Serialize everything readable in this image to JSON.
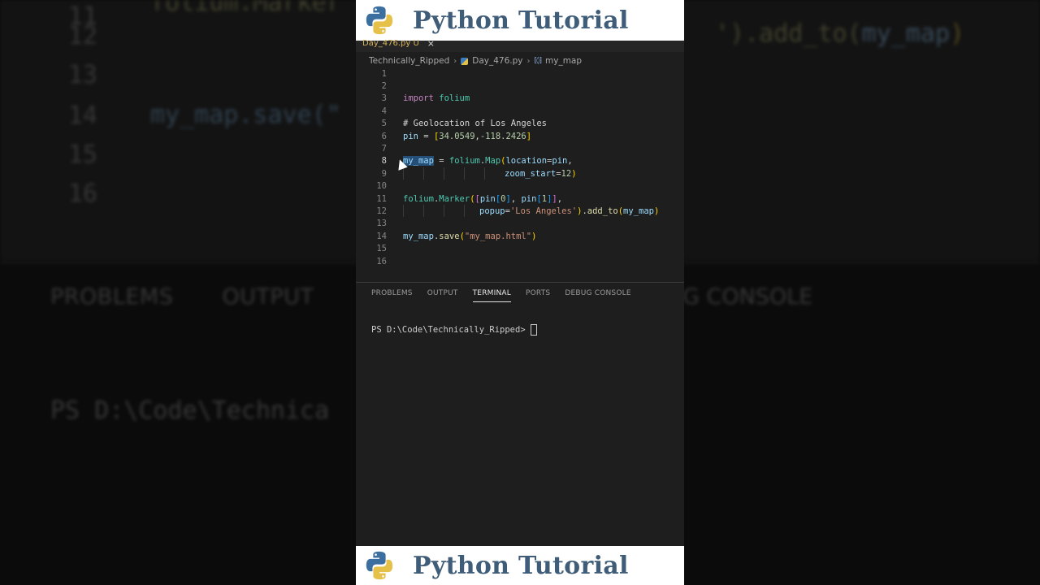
{
  "banner": {
    "title": "Python Tutorial"
  },
  "editor": {
    "tab_label": "Day_476.py U",
    "close_glyph": "×",
    "breadcrumb": [
      "Technically_Ripped",
      "Day_476.py",
      "my_map"
    ],
    "line_numbers": [
      "1",
      "2",
      "3",
      "4",
      "5",
      "6",
      "7",
      "8",
      "9",
      "10",
      "11",
      "12",
      "13",
      "14",
      "15",
      "16"
    ],
    "code": {
      "l3_import": "import",
      "l3_mod": "folium",
      "l5_comment": "# Geolocation of Los Angeles",
      "l6_var": "pin",
      "l6_eq": " = ",
      "l6_open": "[",
      "l6_num1": "34.0549",
      "l6_comma": ",",
      "l6_num2": "-118.2426",
      "l6_close": "]",
      "l8_var": "my_map",
      "l8_eq": " = ",
      "l8_mod": "folium",
      "l8_dot": ".",
      "l8_fn": "Map",
      "l8_open": "(",
      "l8_arg": "location",
      "l8_eq2": "=",
      "l8_val": "pin",
      "l8_comma": ",",
      "l9_arg": "zoom_start",
      "l9_eq": "=",
      "l9_num": "12",
      "l9_close": ")",
      "l11_mod": "folium",
      "l11_dot": ".",
      "l11_fn": "Marker",
      "l11_open1": "(",
      "l11_open2": "[",
      "l11_pin1": "pin",
      "l11_idx1o": "[",
      "l11_idx1": "0",
      "l11_idx1c": "]",
      "l11_sep": ", ",
      "l11_pin2": "pin",
      "l11_idx2o": "[",
      "l11_idx2": "1",
      "l11_idx2c": "]",
      "l11_close2": "]",
      "l11_comma": ",",
      "l12_arg": "popup",
      "l12_eq": "=",
      "l12_str": "'Los Angeles'",
      "l12_close": ")",
      "l12_dot": ".",
      "l12_fn": "add_to",
      "l12_open": "(",
      "l12_var": "my_map",
      "l12_close2": ")",
      "l14_var": "my_map",
      "l14_dot": ".",
      "l14_fn": "save",
      "l14_open": "(",
      "l14_str": "\"my_map.html\"",
      "l14_close": ")"
    },
    "active_line": "8"
  },
  "panel": {
    "tabs": [
      "PROBLEMS",
      "OUTPUT",
      "TERMINAL",
      "PORTS",
      "DEBUG CONSOLE"
    ],
    "active_tab": "TERMINAL",
    "terminal_prompt": "PS D:\\Code\\Technically_Ripped>"
  },
  "background": {
    "line_numbers": [
      "11",
      "12",
      "13",
      "14",
      "15",
      "16"
    ],
    "code_top": "folium.Marker",
    "code_line12_tail_str": "'",
    "code_line12_tail": ").add_to(",
    "code_line12_var": "my_map",
    "code_line12_close": ")",
    "code_line14": "my_map.save(\"",
    "tabs": [
      "PROBLEMS",
      "OUTPUT",
      "T"
    ],
    "tabs_right": "G CONSOLE",
    "terminal": "PS D:\\Code\\Technica"
  },
  "colors": {
    "banner_text": "#3f5d78",
    "editor_bg": "#1e1e1e",
    "selection": "#264f78",
    "keyword_import": "#c586c0",
    "module": "#4ec9b0",
    "variable": "#9cdcfe",
    "function": "#dcdcaa",
    "number": "#b5cea8",
    "string": "#ce9178",
    "comment": "#6a9955"
  },
  "icons": [
    "python-logo-icon",
    "python-file-icon",
    "symbol-icon",
    "close-icon",
    "chevron-right-icon",
    "mouse-cursor-icon"
  ]
}
